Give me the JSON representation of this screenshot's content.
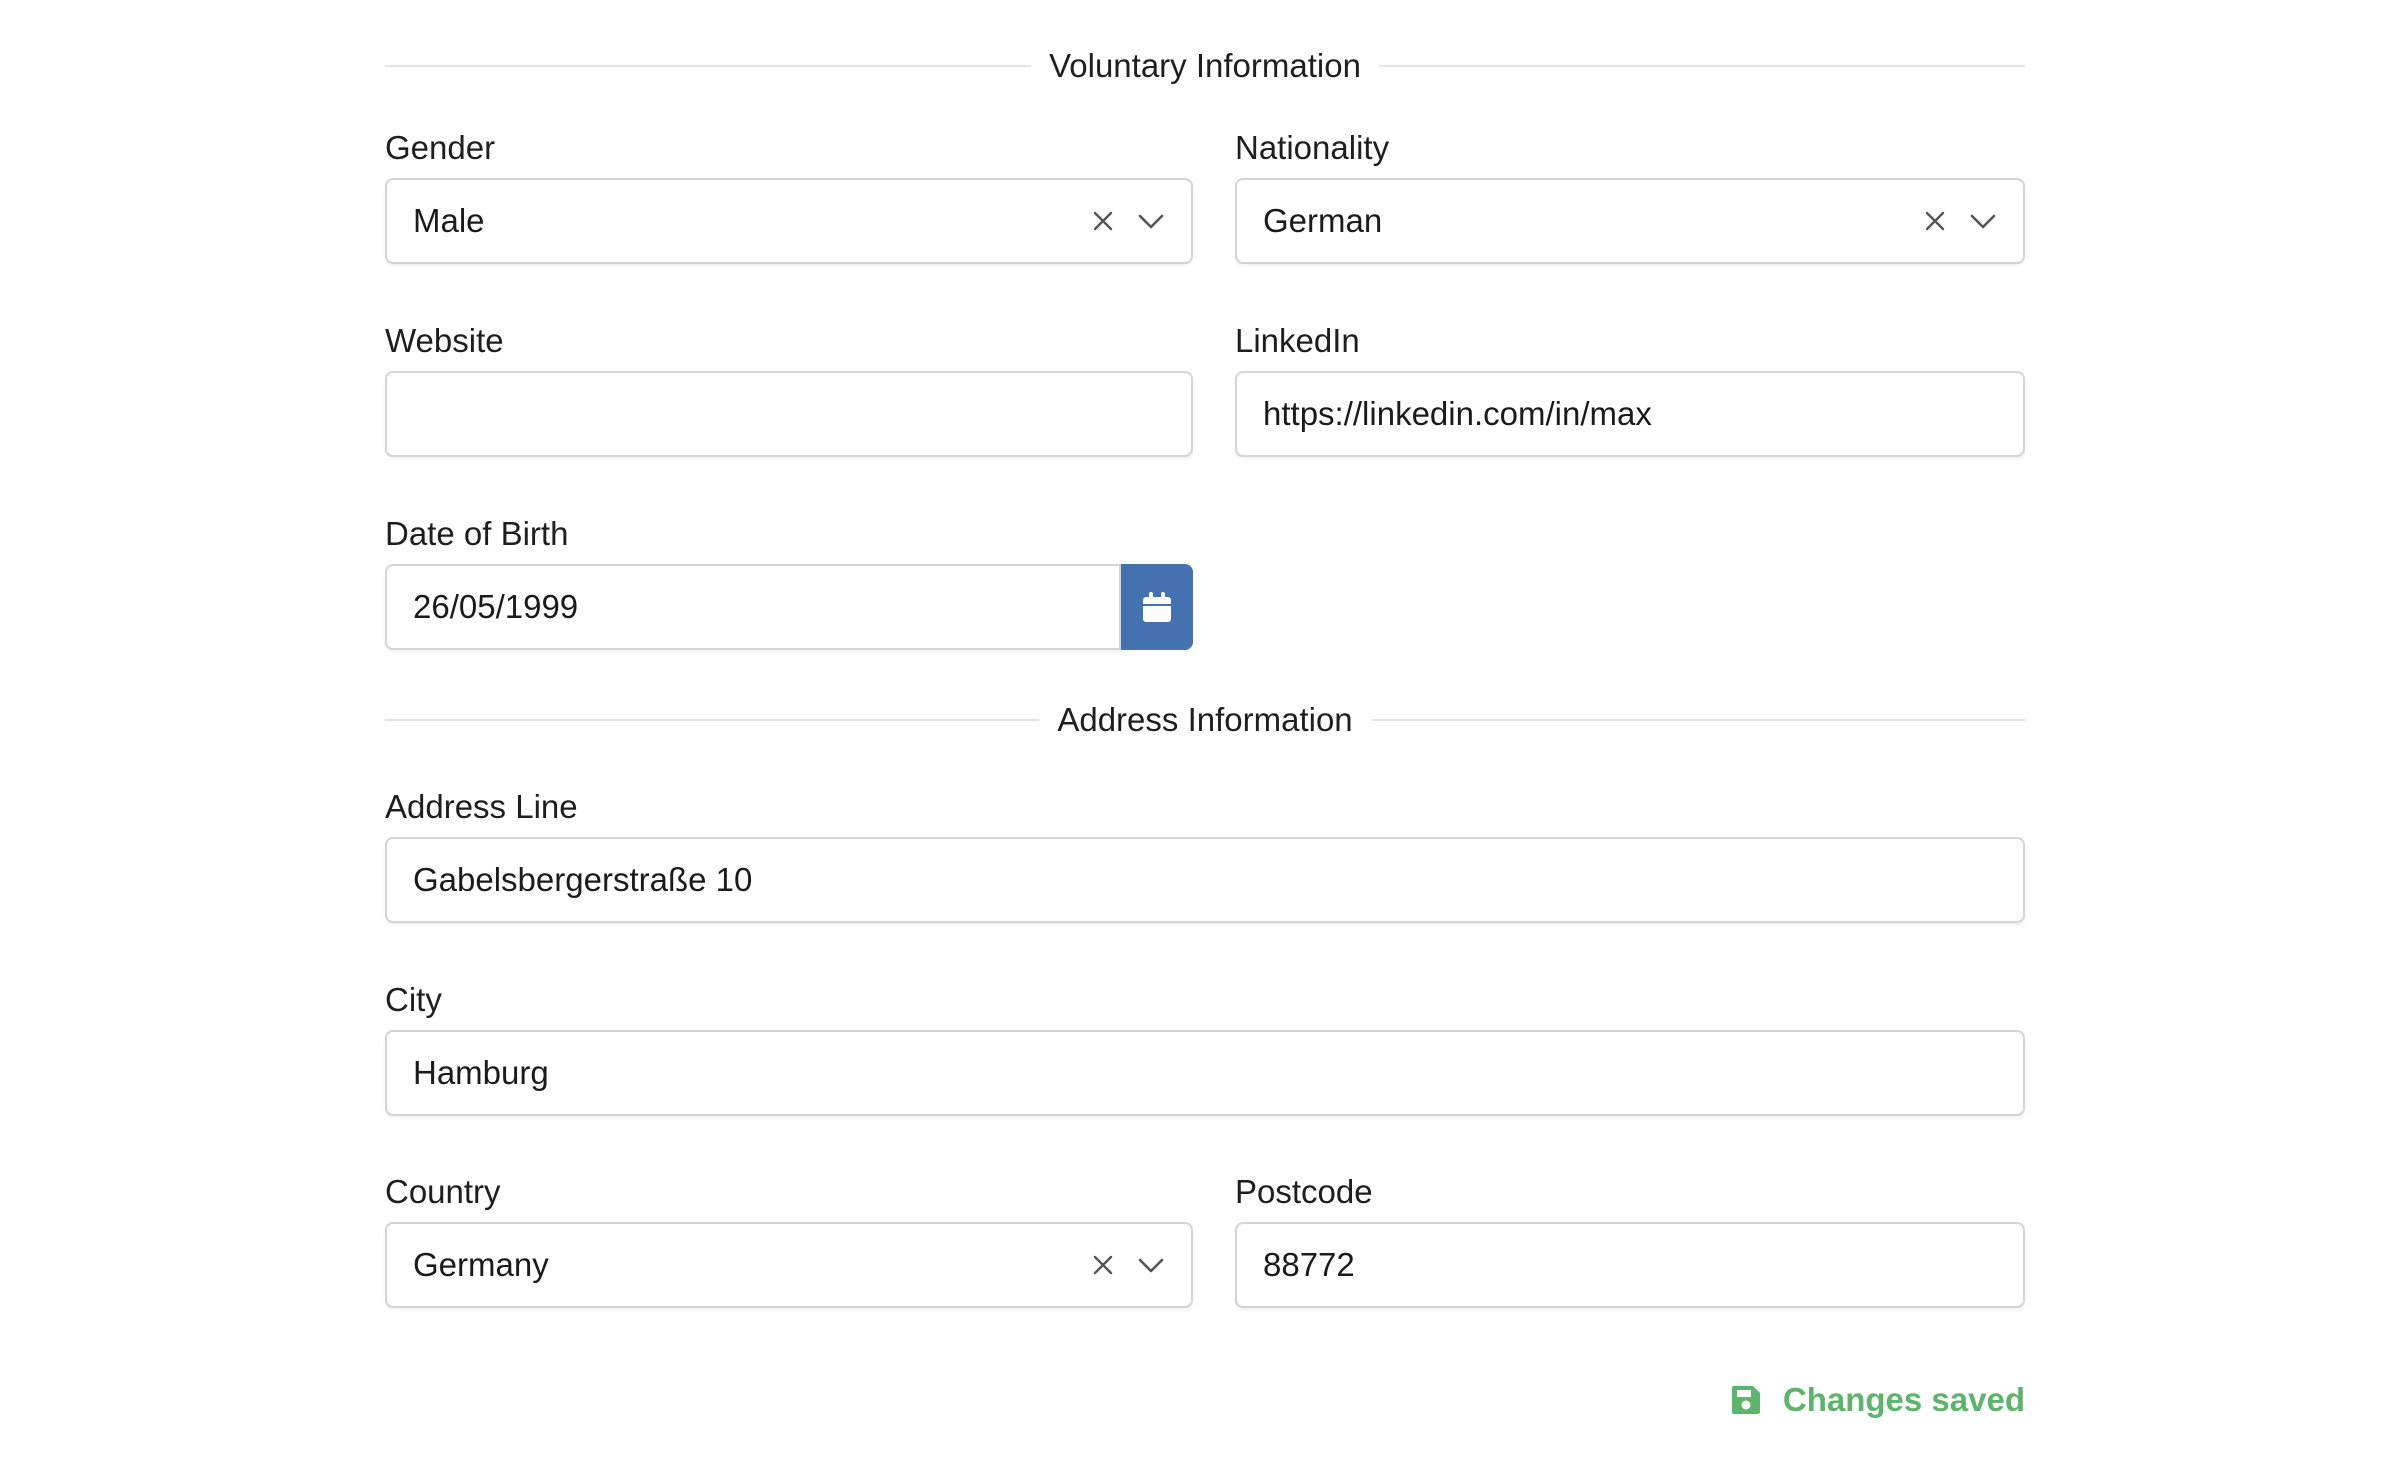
{
  "sections": {
    "voluntary_title": "Voluntary Information",
    "address_title": "Address Information"
  },
  "fields": {
    "gender": {
      "label": "Gender",
      "value": "Male"
    },
    "nationality": {
      "label": "Nationality",
      "value": "German"
    },
    "website": {
      "label": "Website",
      "value": ""
    },
    "linkedin": {
      "label": "LinkedIn",
      "value": "https://linkedin.com/in/max"
    },
    "dob": {
      "label": "Date of Birth",
      "value": "26/05/1999"
    },
    "address_line": {
      "label": "Address Line",
      "value": "Gabelsbergerstraße 10"
    },
    "city": {
      "label": "City",
      "value": "Hamburg"
    },
    "country": {
      "label": "Country",
      "value": "Germany"
    },
    "postcode": {
      "label": "Postcode",
      "value": "88772"
    }
  },
  "status": {
    "text": "Changes saved",
    "icon": "floppy-disk-icon"
  },
  "colors": {
    "accent_blue": "#4472b0",
    "success_green": "#5cb56a",
    "border": "#d4d4d4",
    "divider": "#e5e5e5"
  }
}
